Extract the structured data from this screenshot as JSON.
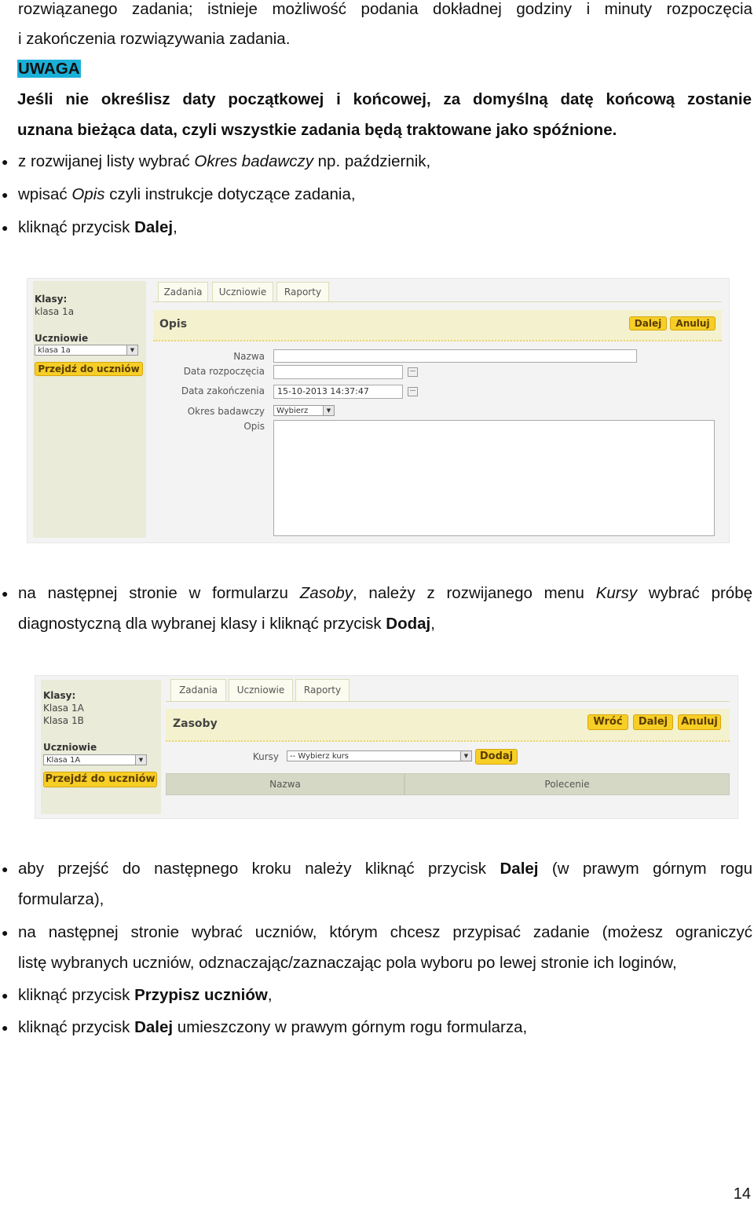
{
  "intro": {
    "line1": "rozwiązanego zadania; istnieje możliwość podania dokładnej godziny i minuty rozpoczęcia",
    "line2": "i zakończenia rozwiązywania zadania.",
    "warning_label": "UWAGA",
    "warning_line1": "Jeśli nie określisz daty początkowej i końcowej, za domyślną datę końcową zostanie",
    "warning_line2": "uznana bieżąca data, czyli wszystkie zadania będą traktowane jako spóźnione."
  },
  "steps1": {
    "b1_pre": "z rozwijanej listy wybrać ",
    "b1_em": "Okres badawczy",
    "b1_post": " np. październik,",
    "b2_pre": "wpisać ",
    "b2_em": "Opis",
    "b2_post": " czyli instrukcje dotyczące zadania,",
    "b3_pre": "kliknąć przycisk ",
    "b3_strong": "Dalej",
    "b3_post": ","
  },
  "shot1": {
    "sidebar": {
      "classes_label": "Klasy:",
      "class_item": "klasa 1a",
      "students_label": "Uczniowie",
      "students_select": "klasa 1a",
      "goto_button": "Przejdź do uczniów"
    },
    "tabs": [
      "Zadania",
      "Uczniowie",
      "Raporty"
    ],
    "header_title": "Opis",
    "next_button": "Dalej",
    "cancel_button": "Anuluj",
    "fields": {
      "name_label": "Nazwa",
      "start_label": "Data rozpoczęcia",
      "end_label": "Data zakończenia",
      "end_value": "15-10-2013 14:37:47",
      "period_label": "Okres badawczy",
      "period_value": "Wybierz",
      "desc_label": "Opis"
    }
  },
  "steps2": {
    "b1_line1_pre": "na następnej stronie w formularzu ",
    "b1_line1_em1": "Zasoby",
    "b1_line1_mid": ", należy z rozwijanego menu ",
    "b1_line1_em2": "Kursy",
    "b1_line1_post": " wybrać próbę",
    "b1_line2_pre": "diagnostyczną dla wybranej klasy i kliknąć przycisk ",
    "b1_line2_strong": "Dodaj",
    "b1_line2_post": ","
  },
  "shot2": {
    "sidebar": {
      "classes_label": "Klasy:",
      "class_items": [
        "Klasa 1A",
        "Klasa 1B"
      ],
      "students_label": "Uczniowie",
      "students_select": "Klasa 1A",
      "goto_button": "Przejdź do uczniów"
    },
    "tabs": [
      "Zadania",
      "Uczniowie",
      "Raporty"
    ],
    "header_title": "Zasoby",
    "back_button": "Wróć",
    "next_button": "Dalej",
    "cancel_button": "Anuluj",
    "courses_label": "Kursy",
    "courses_select": "-- Wybierz kurs",
    "add_button": "Dodaj",
    "columns": [
      "Nazwa",
      "Polecenie"
    ]
  },
  "steps3": {
    "b1_line1_pre": "aby przejść do następnego kroku należy kliknąć przycisk ",
    "b1_line1_strong": "Dalej",
    "b1_line1_post": " (w prawym górnym rogu",
    "b1_line2": "formularza),",
    "b2_line1": "na następnej stronie wybrać uczniów, którym chcesz przypisać zadanie (możesz ograniczyć",
    "b2_line2": "listę wybranych uczniów, odznaczając/zaznaczając pola wyboru po lewej stronie ich loginów,",
    "b3_pre": "kliknąć przycisk ",
    "b3_strong": "Przypisz uczniów",
    "b3_post": ",",
    "b4_pre": "kliknąć przycisk ",
    "b4_strong": "Dalej",
    "b4_post": " umieszczony w prawym górnym rogu formularza,"
  },
  "page_number": "14"
}
